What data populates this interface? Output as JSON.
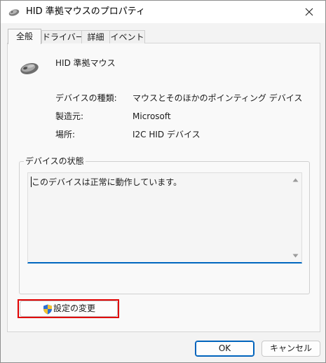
{
  "window": {
    "title": "HID 準拠マウスのプロパティ",
    "title_icon": "mouse-icon",
    "close_icon": "close-icon"
  },
  "tabs": [
    {
      "label": "全般",
      "active": true
    },
    {
      "label": "ドライバー",
      "active": false
    },
    {
      "label": "詳細",
      "active": false
    },
    {
      "label": "イベント",
      "active": false
    }
  ],
  "device": {
    "icon": "mouse-icon",
    "name": "HID 準拠マウス"
  },
  "properties": [
    {
      "label": "デバイスの種類:",
      "value": "マウスとそのほかのポインティング デバイス"
    },
    {
      "label": "製造元:",
      "value": "Microsoft"
    },
    {
      "label": "場所:",
      "value": "I2C HID デバイス"
    }
  ],
  "status": {
    "group_title": "デバイスの状態",
    "text": "このデバイスは正常に動作しています。"
  },
  "change_settings": {
    "label": "設定の変更",
    "icon": "uac-shield-icon",
    "highlight_color": "#e00000"
  },
  "buttons": {
    "ok_label": "OK",
    "cancel_label": "キャンセル"
  },
  "colors": {
    "accent": "#0067c0"
  }
}
